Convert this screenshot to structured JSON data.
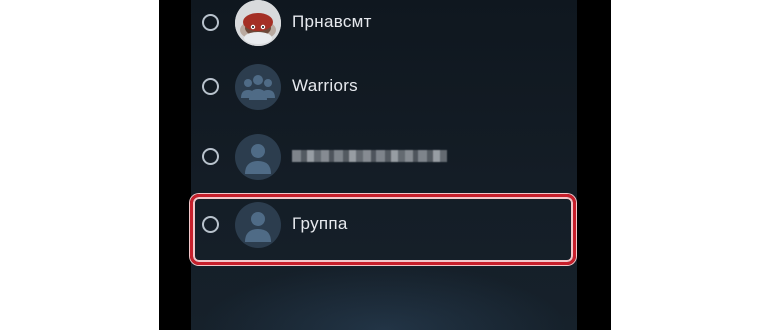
{
  "contacts": [
    {
      "name": "Прнавсмт",
      "avatar": "photo-avatar",
      "selected": false
    },
    {
      "name": "Warriors",
      "avatar": "group-avatar-icon",
      "selected": false
    },
    {
      "name": "",
      "avatar": "user-avatar-icon",
      "selected": false,
      "name_obscured": true
    },
    {
      "name": "Группа",
      "avatar": "user-avatar-icon",
      "selected": false,
      "highlighted": true
    }
  ],
  "colors": {
    "background": "#0f171f",
    "text": "#e6e9ee",
    "radio_border": "#b8c2cc",
    "avatar_bg": "#2c3d4e",
    "avatar_fg": "#4f6b86",
    "highlight_border": "#c71f2b"
  }
}
